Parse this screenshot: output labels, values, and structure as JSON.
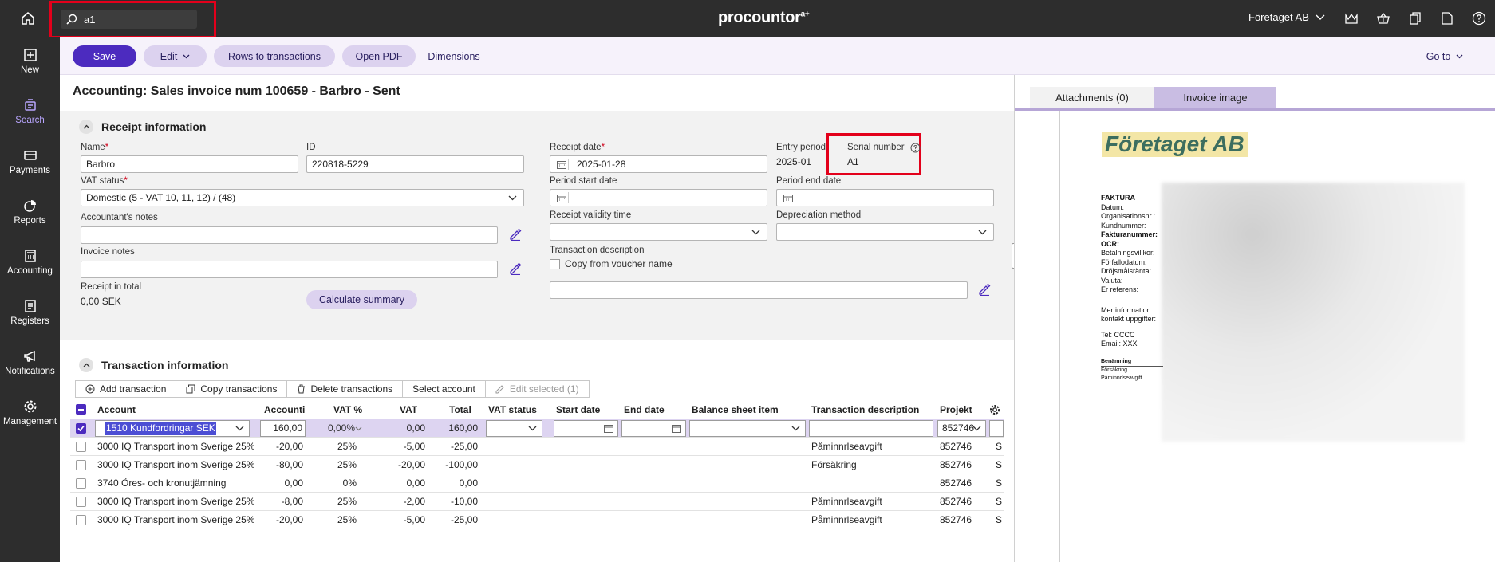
{
  "topbar": {
    "search_value": "a1",
    "logo": "procountor",
    "logo_sup": "a+",
    "company": "Företaget AB"
  },
  "nav": [
    {
      "label": "New",
      "icon": "plus-square-icon"
    },
    {
      "label": "Search",
      "icon": "search-list-icon",
      "active": true
    },
    {
      "label": "Payments",
      "icon": "card-icon"
    },
    {
      "label": "Reports",
      "icon": "pie-chart-icon"
    },
    {
      "label": "Accounting",
      "icon": "calculator-icon"
    },
    {
      "label": "Registers",
      "icon": "register-icon"
    },
    {
      "label": "Notifications",
      "icon": "megaphone-icon"
    },
    {
      "label": "Management",
      "icon": "gear-icon"
    }
  ],
  "toolbar": {
    "save": "Save",
    "edit": "Edit",
    "rows_to_transactions": "Rows to transactions",
    "open_pdf": "Open PDF",
    "dimensions": "Dimensions",
    "go_to": "Go to"
  },
  "page_title": "Accounting: Sales invoice num 100659 - Barbro - Sent",
  "receipt": {
    "section_title": "Receipt information",
    "name_label": "Name",
    "name_value": "Barbro",
    "id_label": "ID",
    "id_value": "220818-5229",
    "vat_status_label": "VAT status",
    "vat_status_value": "Domestic (5 - VAT 10, 11, 12) / (48)",
    "accountants_notes_label": "Accountant's notes",
    "invoice_notes_label": "Invoice notes",
    "receipt_total_label": "Receipt in total",
    "receipt_total_value": "0,00 SEK",
    "calculate_summary": "Calculate summary",
    "receipt_date_label": "Receipt date",
    "receipt_date_value": "2025-01-28",
    "entry_period_label": "Entry period",
    "entry_period_value": "2025-01",
    "serial_number_label": "Serial number",
    "serial_number_value": "A1",
    "period_start_label": "Period start date",
    "period_end_label": "Period end date",
    "validity_label": "Receipt validity time",
    "depreciation_label": "Depreciation method",
    "trans_desc_label": "Transaction description",
    "copy_voucher_label": "Copy from voucher name"
  },
  "transactions": {
    "section_title": "Transaction information",
    "toolbar": [
      "Add transaction",
      "Copy transactions",
      "Delete transactions",
      "Select account",
      "Edit selected (1)"
    ],
    "columns": [
      "Account",
      "Accounti",
      "VAT %",
      "VAT",
      "Total",
      "VAT status",
      "Start date",
      "End date",
      "Balance sheet item",
      "Transaction description",
      "Projekt"
    ],
    "selected_row": {
      "account": "1510 Kundfordringar SEK",
      "amount": "160,00",
      "vat_pct": "0,00%",
      "vat": "0,00",
      "total": "160,00",
      "projekt": "852746"
    },
    "rows": [
      {
        "account": "3000 IQ Transport inom Sverige 25%",
        "amount": "-20,00",
        "vat_pct": "25%",
        "vat": "-5,00",
        "total": "-25,00",
        "desc": "Påminnrlseavgift",
        "projekt": "852746",
        "extra": "S"
      },
      {
        "account": "3000 IQ Transport inom Sverige 25%",
        "amount": "-80,00",
        "vat_pct": "25%",
        "vat": "-20,00",
        "total": "-100,00",
        "desc": "Försäkring",
        "projekt": "852746",
        "extra": "S"
      },
      {
        "account": "3740 Öres- och kronutjämning",
        "amount": "0,00",
        "vat_pct": "0%",
        "vat": "0,00",
        "total": "0,00",
        "desc": "",
        "projekt": "852746",
        "extra": "S"
      },
      {
        "account": "3000 IQ Transport inom Sverige 25%",
        "amount": "-8,00",
        "vat_pct": "25%",
        "vat": "-2,00",
        "total": "-10,00",
        "desc": "Påminnrlseavgift",
        "projekt": "852746",
        "extra": "S"
      },
      {
        "account": "3000 IQ Transport inom Sverige 25%",
        "amount": "-20,00",
        "vat_pct": "25%",
        "vat": "-5,00",
        "total": "-25,00",
        "desc": "Påminnrlseavgift",
        "projekt": "852746",
        "extra": "S"
      }
    ]
  },
  "right_panel": {
    "tab_attachments": "Attachments (0)",
    "tab_invoice_image": "Invoice image",
    "doc_logo": "Företaget AB",
    "doc_title": "FAKTURA",
    "doc_labels": [
      "Datum:",
      "Organisationsnr.:",
      "Kundnummer:",
      "Fakturanummer:",
      "OCR:",
      "Betalningsvillkor:",
      "Förfallodatum:",
      "Dröjsmålsränta:",
      "Valuta:",
      "Er referens:"
    ],
    "doc_more": [
      "Mer information:",
      "kontakt uppgifter:"
    ],
    "doc_contact": [
      "Tel: CCCC",
      "Email: XXX"
    ],
    "doc_items_head": "Benämning",
    "doc_items": [
      "Försäkring",
      "Påminnrlseavgift"
    ]
  }
}
